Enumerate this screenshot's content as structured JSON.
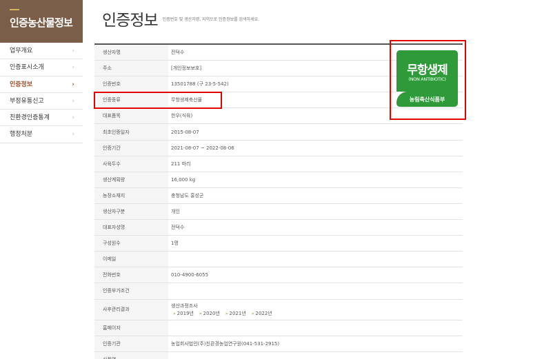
{
  "sidebar": {
    "title": "인증농산물정보",
    "items": [
      {
        "label": "업무개요",
        "chevron": "›"
      },
      {
        "label": "인증표시소개",
        "chevron": "›"
      },
      {
        "label": "인증정보",
        "chevron": "›"
      },
      {
        "label": "부정유통신고",
        "chevron": "›"
      },
      {
        "label": "친환경인증통계",
        "chevron": "›"
      },
      {
        "label": "행정처분",
        "chevron": "›"
      }
    ],
    "active_index": 2,
    "colors": {
      "header_bg": "#7a5e49",
      "active_text": "#a0522d"
    }
  },
  "page": {
    "title": "인증정보",
    "subtitle": "인증번호 및 생산자명, 지역으로 인증정보를 검색하세요."
  },
  "info_table": {
    "rows": [
      {
        "label": "생산자명",
        "value": "전덕수"
      },
      {
        "label": "주소",
        "value": "[개인정보보호]"
      },
      {
        "label": "인증번호",
        "value": "13501788 (구 23-5-542)"
      },
      {
        "label": "인증종류",
        "value": "무항생제축산물"
      },
      {
        "label": "대표품목",
        "value": "한우(식육)"
      },
      {
        "label": "최초인증일자",
        "value": "2015-08-07"
      },
      {
        "label": "인증기간",
        "value": "2021-08-07 ~ 2022-08-06"
      },
      {
        "label": "사육두수",
        "value": "211 마리"
      },
      {
        "label": "생산계획량",
        "value": "16,000 kg"
      },
      {
        "label": "농장소재지",
        "value": "충청남도 홍성군"
      },
      {
        "label": "생산자구분",
        "value": "개인"
      },
      {
        "label": "대표자성명",
        "value": "전덕수"
      },
      {
        "label": "구성원수",
        "value": "1명"
      },
      {
        "label": "이메일",
        "value": ""
      },
      {
        "label": "전화번호",
        "value": "010-4900-6055"
      },
      {
        "label": "인증부가조건",
        "value": ""
      },
      {
        "label": "사후관리결과",
        "value": "생산과정조사",
        "years": [
          "2019년",
          "2020년",
          "2021년",
          "2022년"
        ]
      },
      {
        "label": "홈페이지",
        "value": ""
      },
      {
        "label": "인증기관",
        "value": "농업회사법인(주)친환경농업연구원(041-531-2915)"
      },
      {
        "label": "상품명",
        "value": ""
      }
    ],
    "year_bullet": "»"
  },
  "certification_mark": {
    "line1": "무항생제",
    "line2": "(NON ANTIBIOTIC)",
    "line3": "농림축산식품부",
    "color": "#2f9a3a"
  },
  "highlight_color": "#e30000"
}
